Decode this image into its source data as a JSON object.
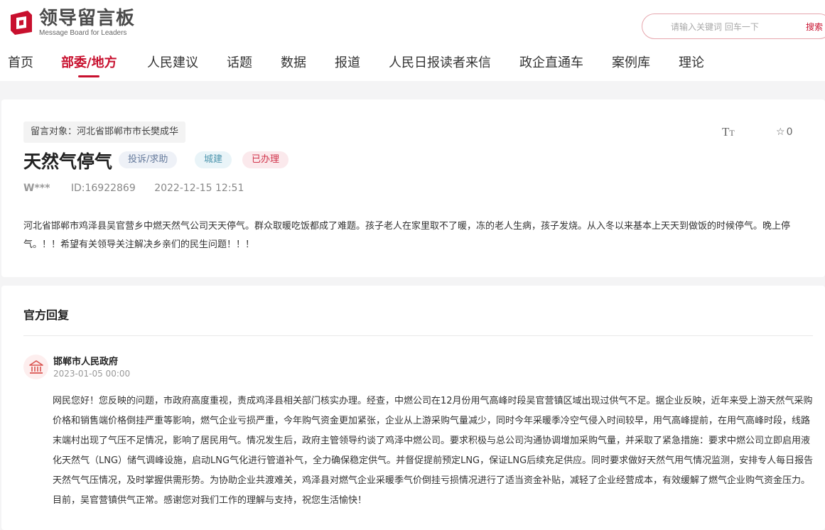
{
  "brand": {
    "title": "领导留言板",
    "subtitle": "Message Board for Leaders",
    "accent": "#c8102e"
  },
  "search": {
    "placeholder": "请输入关键词 回车一下",
    "button_label": "搜索"
  },
  "nav": {
    "items": [
      {
        "label": "首页",
        "active": false
      },
      {
        "label": "部委/地方",
        "active": true
      },
      {
        "label": "人民建议",
        "active": false
      },
      {
        "label": "话题",
        "active": false
      },
      {
        "label": "数据",
        "active": false
      },
      {
        "label": "报道",
        "active": false
      },
      {
        "label": "人民日报读者来信",
        "active": false
      },
      {
        "label": "政企直通车",
        "active": false
      },
      {
        "label": "案例库",
        "active": false
      },
      {
        "label": "理论",
        "active": false
      }
    ]
  },
  "message": {
    "target": "留言对象：河北省邯郸市市长樊成华",
    "font_toggle": "TT",
    "favorite_count": "0",
    "title": "天然气停气",
    "tags": [
      "投诉/求助",
      "城建",
      "已办理"
    ],
    "author": "W***",
    "id": "ID:16922869",
    "datetime": "2022-12-15 12:51",
    "content": "河北省邯郸市鸡泽县吴官营乡中燃天然气公司天天停气。群众取暖吃饭都成了难题。孩子老人在家里取不了暖，冻的老人生病，孩子发烧。从入冬以来基本上天天到做饭的时候停气。晚上停气。！！希望有关领导关注解决乡亲们的民生问题！！！"
  },
  "reply": {
    "section_title": "官方回复",
    "org_name": "邯郸市人民政府",
    "datetime": "2023-01-05 00:00",
    "content": "网民您好！您反映的问题，市政府高度重视，责成鸡泽县相关部门核实办理。经查，中燃公司在12月份用气高峰时段吴官营镇区域出现过供气不足。据企业反映，近年来受上游天然气采购价格和销售端价格倒挂严重等影响，燃气企业亏损严重，今年购气资金更加紧张，企业从上游采购气量减少，同时今年采暖季冷空气侵入时间较早，用气高峰提前，在用气高峰时段，线路末端村出现了气压不足情况，影响了居民用气。情况发生后，政府主管领导约谈了鸡泽中燃公司。要求积极与总公司沟通协调增加采购气量，并采取了紧急措施：要求中燃公司立即启用液化天然气（LNG）储气调峰设施，启动LNG气化进行管道补气，全力确保稳定供气。并督促提前预定LNG，保证LNG后续充足供应。同时要求做好天然气用气情况监测，安排专人每日报告天然气气压情况，及时掌握供需形势。为协助企业共渡难关，鸡泽县对燃气企业采暖季气价倒挂亏损情况进行了适当资金补贴，减轻了企业经营成本，有效缓解了燃气企业购气资金压力。目前，吴官营镇供气正常。感谢您对我们工作的理解与支持，祝您生活愉快！"
  }
}
